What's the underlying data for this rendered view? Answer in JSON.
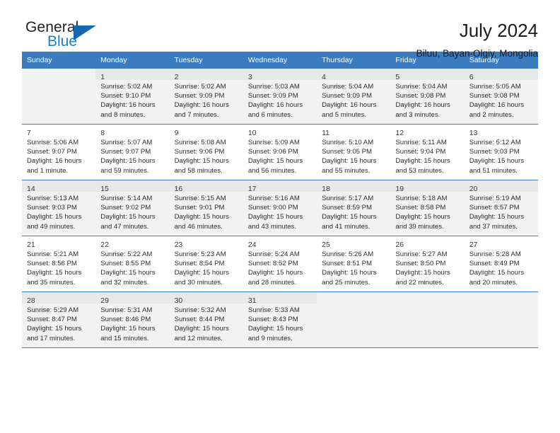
{
  "brand": {
    "name_top": "General",
    "name_bottom": "Blue",
    "triangle_color": "#1567b0",
    "blue_color": "#1b7fc4"
  },
  "header": {
    "title": "July 2024",
    "subtitle": "Biluu, Bayan-Olgiy, Mongolia"
  },
  "colors": {
    "header_row_bg": "#3b7cc0",
    "header_row_text": "#ffffff",
    "row_shaded_bg": "#f2f2f2",
    "grid_line": "#3b7cc0"
  },
  "weekday_headers": [
    "Sunday",
    "Monday",
    "Tuesday",
    "Wednesday",
    "Thursday",
    "Friday",
    "Saturday"
  ],
  "weeks": [
    {
      "shaded": true,
      "days": [
        {
          "num": "",
          "lines": []
        },
        {
          "num": "1",
          "lines": [
            "Sunrise: 5:02 AM",
            "Sunset: 9:10 PM",
            "Daylight: 16 hours",
            "and 8 minutes."
          ]
        },
        {
          "num": "2",
          "lines": [
            "Sunrise: 5:02 AM",
            "Sunset: 9:09 PM",
            "Daylight: 16 hours",
            "and 7 minutes."
          ]
        },
        {
          "num": "3",
          "lines": [
            "Sunrise: 5:03 AM",
            "Sunset: 9:09 PM",
            "Daylight: 16 hours",
            "and 6 minutes."
          ]
        },
        {
          "num": "4",
          "lines": [
            "Sunrise: 5:04 AM",
            "Sunset: 9:09 PM",
            "Daylight: 16 hours",
            "and 5 minutes."
          ]
        },
        {
          "num": "5",
          "lines": [
            "Sunrise: 5:04 AM",
            "Sunset: 9:08 PM",
            "Daylight: 16 hours",
            "and 3 minutes."
          ]
        },
        {
          "num": "6",
          "lines": [
            "Sunrise: 5:05 AM",
            "Sunset: 9:08 PM",
            "Daylight: 16 hours",
            "and 2 minutes."
          ]
        }
      ]
    },
    {
      "shaded": false,
      "days": [
        {
          "num": "7",
          "lines": [
            "Sunrise: 5:06 AM",
            "Sunset: 9:07 PM",
            "Daylight: 16 hours",
            "and 1 minute."
          ]
        },
        {
          "num": "8",
          "lines": [
            "Sunrise: 5:07 AM",
            "Sunset: 9:07 PM",
            "Daylight: 15 hours",
            "and 59 minutes."
          ]
        },
        {
          "num": "9",
          "lines": [
            "Sunrise: 5:08 AM",
            "Sunset: 9:06 PM",
            "Daylight: 15 hours",
            "and 58 minutes."
          ]
        },
        {
          "num": "10",
          "lines": [
            "Sunrise: 5:09 AM",
            "Sunset: 9:06 PM",
            "Daylight: 15 hours",
            "and 56 minutes."
          ]
        },
        {
          "num": "11",
          "lines": [
            "Sunrise: 5:10 AM",
            "Sunset: 9:05 PM",
            "Daylight: 15 hours",
            "and 55 minutes."
          ]
        },
        {
          "num": "12",
          "lines": [
            "Sunrise: 5:11 AM",
            "Sunset: 9:04 PM",
            "Daylight: 15 hours",
            "and 53 minutes."
          ]
        },
        {
          "num": "13",
          "lines": [
            "Sunrise: 5:12 AM",
            "Sunset: 9:03 PM",
            "Daylight: 15 hours",
            "and 51 minutes."
          ]
        }
      ]
    },
    {
      "shaded": true,
      "days": [
        {
          "num": "14",
          "lines": [
            "Sunrise: 5:13 AM",
            "Sunset: 9:03 PM",
            "Daylight: 15 hours",
            "and 49 minutes."
          ]
        },
        {
          "num": "15",
          "lines": [
            "Sunrise: 5:14 AM",
            "Sunset: 9:02 PM",
            "Daylight: 15 hours",
            "and 47 minutes."
          ]
        },
        {
          "num": "16",
          "lines": [
            "Sunrise: 5:15 AM",
            "Sunset: 9:01 PM",
            "Daylight: 15 hours",
            "and 46 minutes."
          ]
        },
        {
          "num": "17",
          "lines": [
            "Sunrise: 5:16 AM",
            "Sunset: 9:00 PM",
            "Daylight: 15 hours",
            "and 43 minutes."
          ]
        },
        {
          "num": "18",
          "lines": [
            "Sunrise: 5:17 AM",
            "Sunset: 8:59 PM",
            "Daylight: 15 hours",
            "and 41 minutes."
          ]
        },
        {
          "num": "19",
          "lines": [
            "Sunrise: 5:18 AM",
            "Sunset: 8:58 PM",
            "Daylight: 15 hours",
            "and 39 minutes."
          ]
        },
        {
          "num": "20",
          "lines": [
            "Sunrise: 5:19 AM",
            "Sunset: 8:57 PM",
            "Daylight: 15 hours",
            "and 37 minutes."
          ]
        }
      ]
    },
    {
      "shaded": false,
      "days": [
        {
          "num": "21",
          "lines": [
            "Sunrise: 5:21 AM",
            "Sunset: 8:56 PM",
            "Daylight: 15 hours",
            "and 35 minutes."
          ]
        },
        {
          "num": "22",
          "lines": [
            "Sunrise: 5:22 AM",
            "Sunset: 8:55 PM",
            "Daylight: 15 hours",
            "and 32 minutes."
          ]
        },
        {
          "num": "23",
          "lines": [
            "Sunrise: 5:23 AM",
            "Sunset: 8:54 PM",
            "Daylight: 15 hours",
            "and 30 minutes."
          ]
        },
        {
          "num": "24",
          "lines": [
            "Sunrise: 5:24 AM",
            "Sunset: 8:52 PM",
            "Daylight: 15 hours",
            "and 28 minutes."
          ]
        },
        {
          "num": "25",
          "lines": [
            "Sunrise: 5:26 AM",
            "Sunset: 8:51 PM",
            "Daylight: 15 hours",
            "and 25 minutes."
          ]
        },
        {
          "num": "26",
          "lines": [
            "Sunrise: 5:27 AM",
            "Sunset: 8:50 PM",
            "Daylight: 15 hours",
            "and 22 minutes."
          ]
        },
        {
          "num": "27",
          "lines": [
            "Sunrise: 5:28 AM",
            "Sunset: 8:49 PM",
            "Daylight: 15 hours",
            "and 20 minutes."
          ]
        }
      ]
    },
    {
      "shaded": true,
      "days": [
        {
          "num": "28",
          "lines": [
            "Sunrise: 5:29 AM",
            "Sunset: 8:47 PM",
            "Daylight: 15 hours",
            "and 17 minutes."
          ]
        },
        {
          "num": "29",
          "lines": [
            "Sunrise: 5:31 AM",
            "Sunset: 8:46 PM",
            "Daylight: 15 hours",
            "and 15 minutes."
          ]
        },
        {
          "num": "30",
          "lines": [
            "Sunrise: 5:32 AM",
            "Sunset: 8:44 PM",
            "Daylight: 15 hours",
            "and 12 minutes."
          ]
        },
        {
          "num": "31",
          "lines": [
            "Sunrise: 5:33 AM",
            "Sunset: 8:43 PM",
            "Daylight: 15 hours",
            "and 9 minutes."
          ]
        },
        {
          "num": "",
          "lines": []
        },
        {
          "num": "",
          "lines": []
        },
        {
          "num": "",
          "lines": []
        }
      ]
    }
  ]
}
